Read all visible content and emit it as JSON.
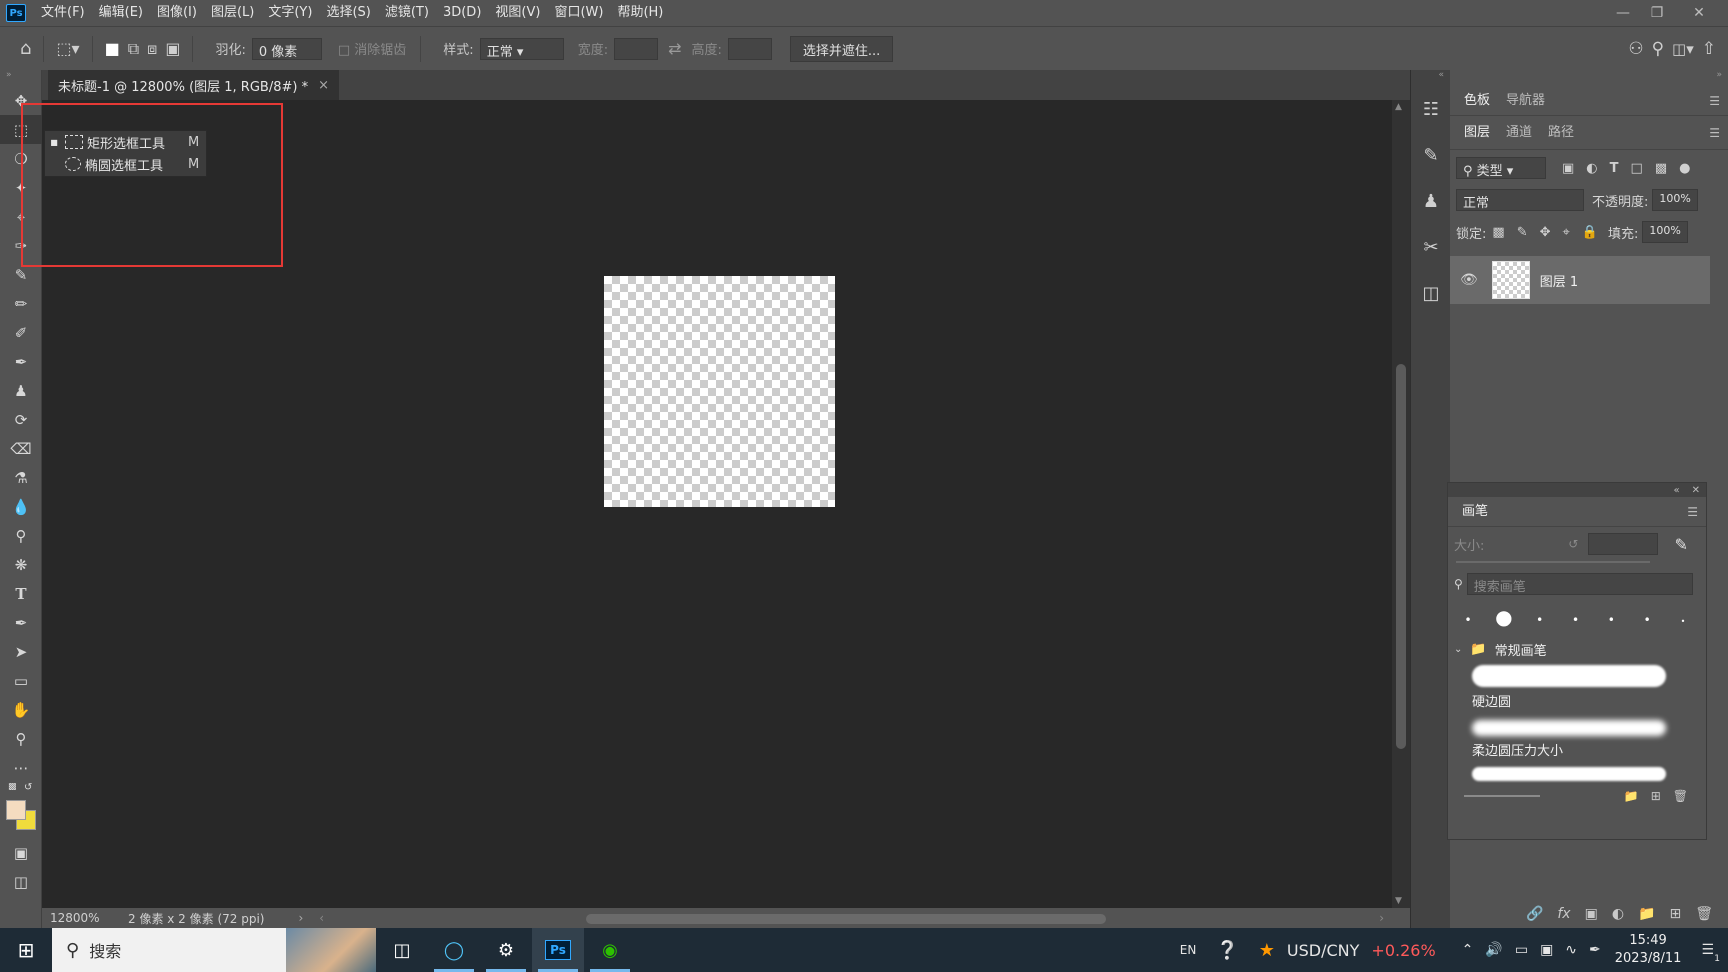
{
  "menubar": {
    "logo": "Ps",
    "items": [
      "文件(F)",
      "编辑(E)",
      "图像(I)",
      "图层(L)",
      "文字(Y)",
      "选择(S)",
      "滤镜(T)",
      "3D(D)",
      "视图(V)",
      "窗口(W)",
      "帮助(H)"
    ]
  },
  "options": {
    "feather_label": "羽化:",
    "feather_value": "0 像素",
    "antialias_label": "消除锯齿",
    "style_label": "样式:",
    "style_value": "正常",
    "width_label": "宽度:",
    "height_label": "高度:",
    "select_mask_button": "选择并遮住..."
  },
  "document": {
    "tab_title": "未标题-1 @ 12800% (图层 1, RGB/8#) *",
    "close": "×"
  },
  "flyout": {
    "items": [
      {
        "label": "矩形选框工具",
        "shortcut": "M",
        "selected": true
      },
      {
        "label": "椭圆选框工具",
        "shortcut": "M",
        "selected": false
      }
    ]
  },
  "status": {
    "zoom": "12800%",
    "info": "2 像素 x 2 像素 (72 ppi)"
  },
  "panels": {
    "top_tabs": [
      "色板",
      "导航器"
    ],
    "layer_tabs": [
      "图层",
      "通道",
      "路径"
    ],
    "filter_kind": "类型",
    "blend_mode": "正常",
    "opacity_label": "不透明度:",
    "opacity_value": "100%",
    "lock_label": "锁定:",
    "fill_label": "填充:",
    "fill_value": "100%",
    "layer_name": "图层 1"
  },
  "brush_panel": {
    "title": "画笔",
    "size_label": "大小:",
    "search_placeholder": "搜索画笔",
    "group_name": "常规画笔",
    "brushes": [
      "硬边圆",
      "柔边圆压力大小"
    ]
  },
  "taskbar": {
    "search_text": "搜索",
    "lang": "EN",
    "ticker": "USD/CNY",
    "ticker_change": "+0.26%",
    "time": "15:49",
    "date": "2023/8/11",
    "notification_count": "1"
  },
  "colors": {
    "accent_red": "#e53935",
    "ticker_red": "#ff5a5a",
    "foreground_color": "#f4dcc0",
    "background_color": "#f0dc3c"
  }
}
